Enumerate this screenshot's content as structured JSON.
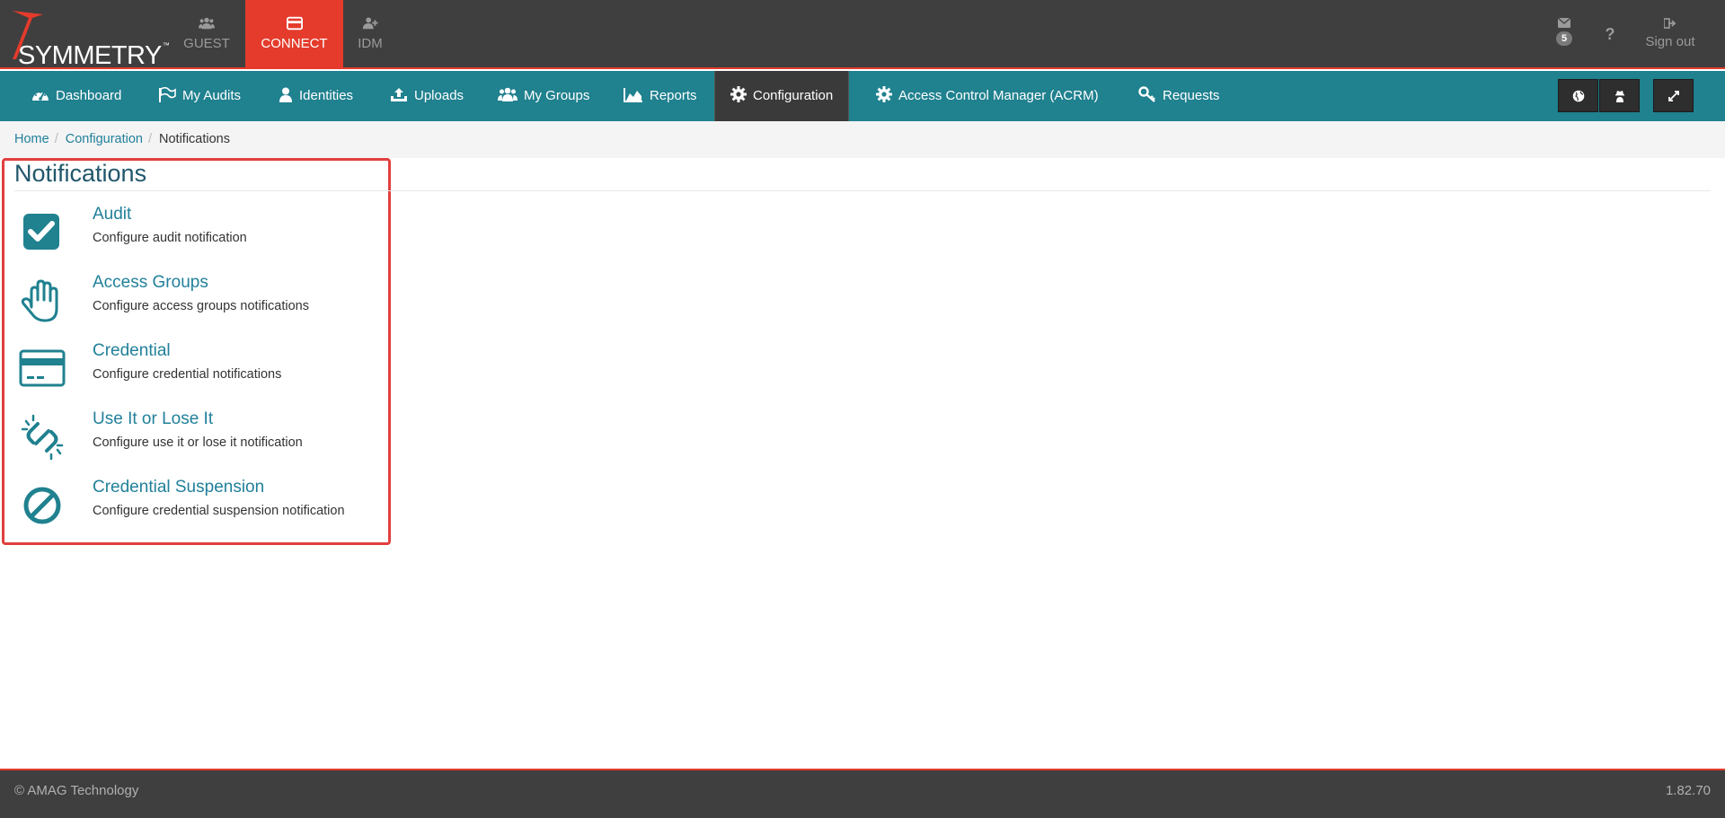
{
  "header": {
    "logo_text": "SYMMETRY",
    "logo_tm": "™",
    "app_tabs": [
      {
        "label": "GUEST",
        "icon": "users-icon"
      },
      {
        "label": "CONNECT",
        "icon": "card-icon"
      },
      {
        "label": "IDM",
        "icon": "user-plus-icon"
      }
    ],
    "mail_count": "5",
    "help_label": "?",
    "signout_label": "Sign out"
  },
  "nav": {
    "items": [
      {
        "label": "Dashboard",
        "icon": "dashboard-icon"
      },
      {
        "label": "My Audits",
        "icon": "flag-icon"
      },
      {
        "label": "Identities",
        "icon": "user-icon"
      },
      {
        "label": "Uploads",
        "icon": "upload-icon"
      },
      {
        "label": "My Groups",
        "icon": "users-icon"
      },
      {
        "label": "Reports",
        "icon": "area-chart-icon"
      },
      {
        "label": "Configuration",
        "icon": "gear-icon"
      },
      {
        "label": "Access Control Manager (ACRM)",
        "icon": "gear-icon"
      },
      {
        "label": "Requests",
        "icon": "key-icon"
      }
    ],
    "active": "Configuration"
  },
  "breadcrumb": {
    "items": [
      "Home",
      "Configuration",
      "Notifications"
    ],
    "separator": "/"
  },
  "page": {
    "title": "Notifications",
    "items": [
      {
        "title": "Audit",
        "desc": "Configure audit notification",
        "icon": "check-square-icon"
      },
      {
        "title": "Access Groups",
        "desc": "Configure access groups notifications",
        "icon": "hand-icon"
      },
      {
        "title": "Credential",
        "desc": "Configure credential notifications",
        "icon": "credit-card-icon"
      },
      {
        "title": "Use It or Lose It",
        "desc": "Configure use it or lose it notification",
        "icon": "unlink-icon"
      },
      {
        "title": "Credential Suspension",
        "desc": "Configure credential suspension notification",
        "icon": "ban-icon"
      }
    ]
  },
  "footer": {
    "copyright": "© AMAG Technology",
    "version": "1.82.70"
  },
  "colors": {
    "accent": "#e43b2c",
    "nav": "#20818f",
    "link": "#21809a",
    "header_bg": "#3f3f3f"
  }
}
